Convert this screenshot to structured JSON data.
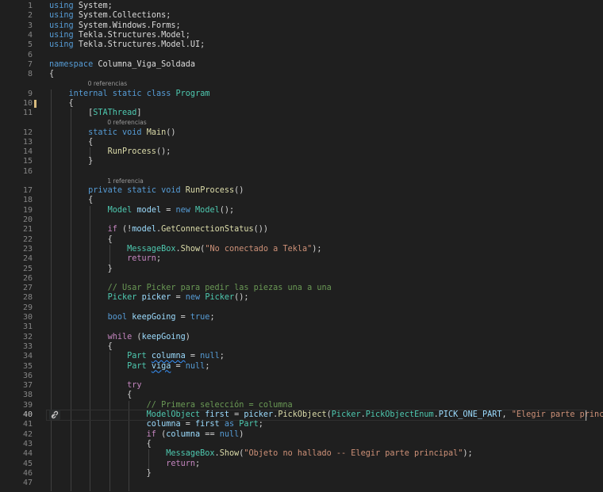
{
  "editor": {
    "active_line": "40",
    "lines": [
      {
        "num": "1",
        "tokens": [
          {
            "t": "using",
            "c": "kw"
          },
          {
            "t": " ",
            "c": "plain"
          },
          {
            "t": "System",
            "c": "ns"
          },
          {
            "t": ";",
            "c": "plain"
          }
        ]
      },
      {
        "num": "2",
        "tokens": [
          {
            "t": "using",
            "c": "kw"
          },
          {
            "t": " ",
            "c": "plain"
          },
          {
            "t": "System.Collections",
            "c": "ns"
          },
          {
            "t": ";",
            "c": "plain"
          }
        ]
      },
      {
        "num": "3",
        "tokens": [
          {
            "t": "using",
            "c": "kw"
          },
          {
            "t": " ",
            "c": "plain"
          },
          {
            "t": "System.Windows.Forms",
            "c": "ns"
          },
          {
            "t": ";",
            "c": "plain"
          }
        ]
      },
      {
        "num": "4",
        "tokens": [
          {
            "t": "using",
            "c": "kw"
          },
          {
            "t": " ",
            "c": "plain"
          },
          {
            "t": "Tekla.Structures.Model",
            "c": "ns"
          },
          {
            "t": ";",
            "c": "plain"
          }
        ]
      },
      {
        "num": "5",
        "tokens": [
          {
            "t": "using",
            "c": "kw"
          },
          {
            "t": " ",
            "c": "plain"
          },
          {
            "t": "Tekla.Structures.Model.UI",
            "c": "ns"
          },
          {
            "t": ";",
            "c": "plain"
          }
        ]
      },
      {
        "num": "6",
        "tokens": []
      },
      {
        "num": "7",
        "tokens": [
          {
            "t": "namespace",
            "c": "kw"
          },
          {
            "t": " ",
            "c": "plain"
          },
          {
            "t": "Columna_Viga_Soldada",
            "c": "ns"
          }
        ]
      },
      {
        "num": "8",
        "tokens": [
          {
            "t": "{",
            "c": "plain"
          }
        ]
      },
      {
        "num": "9",
        "ref": "0 referencias",
        "tokens": [
          {
            "t": "    ",
            "c": "plain"
          },
          {
            "t": "internal",
            "c": "kw"
          },
          {
            "t": " ",
            "c": "plain"
          },
          {
            "t": "static",
            "c": "kw"
          },
          {
            "t": " ",
            "c": "plain"
          },
          {
            "t": "class",
            "c": "kw"
          },
          {
            "t": " ",
            "c": "plain"
          },
          {
            "t": "Program",
            "c": "type"
          }
        ]
      },
      {
        "num": "10",
        "changed": true,
        "tokens": [
          {
            "t": "    {",
            "c": "plain"
          }
        ]
      },
      {
        "num": "11",
        "tokens": [
          {
            "t": "        [",
            "c": "plain"
          },
          {
            "t": "STAThread",
            "c": "attr"
          },
          {
            "t": "]",
            "c": "plain"
          }
        ]
      },
      {
        "num": "12",
        "ref": "0 referencias",
        "tokens": [
          {
            "t": "        ",
            "c": "plain"
          },
          {
            "t": "static",
            "c": "kw"
          },
          {
            "t": " ",
            "c": "plain"
          },
          {
            "t": "void",
            "c": "kw"
          },
          {
            "t": " ",
            "c": "plain"
          },
          {
            "t": "Main",
            "c": "fn"
          },
          {
            "t": "()",
            "c": "plain"
          }
        ]
      },
      {
        "num": "13",
        "tokens": [
          {
            "t": "        {",
            "c": "plain"
          }
        ]
      },
      {
        "num": "14",
        "tokens": [
          {
            "t": "            ",
            "c": "plain"
          },
          {
            "t": "RunProcess",
            "c": "fn"
          },
          {
            "t": "();",
            "c": "plain"
          }
        ]
      },
      {
        "num": "15",
        "tokens": [
          {
            "t": "        }",
            "c": "plain"
          }
        ]
      },
      {
        "num": "16",
        "tokens": []
      },
      {
        "num": "17",
        "ref": "1 referencia",
        "tokens": [
          {
            "t": "        ",
            "c": "plain"
          },
          {
            "t": "private",
            "c": "kw"
          },
          {
            "t": " ",
            "c": "plain"
          },
          {
            "t": "static",
            "c": "kw"
          },
          {
            "t": " ",
            "c": "plain"
          },
          {
            "t": "void",
            "c": "kw"
          },
          {
            "t": " ",
            "c": "plain"
          },
          {
            "t": "RunProcess",
            "c": "fn"
          },
          {
            "t": "()",
            "c": "plain"
          }
        ]
      },
      {
        "num": "18",
        "tokens": [
          {
            "t": "        {",
            "c": "plain"
          }
        ]
      },
      {
        "num": "19",
        "tokens": [
          {
            "t": "            ",
            "c": "plain"
          },
          {
            "t": "Model",
            "c": "type"
          },
          {
            "t": " ",
            "c": "plain"
          },
          {
            "t": "model",
            "c": "var"
          },
          {
            "t": " = ",
            "c": "plain"
          },
          {
            "t": "new",
            "c": "kw"
          },
          {
            "t": " ",
            "c": "plain"
          },
          {
            "t": "Model",
            "c": "type"
          },
          {
            "t": "();",
            "c": "plain"
          }
        ]
      },
      {
        "num": "20",
        "tokens": []
      },
      {
        "num": "21",
        "tokens": [
          {
            "t": "            ",
            "c": "plain"
          },
          {
            "t": "if",
            "c": "ctl"
          },
          {
            "t": " (!",
            "c": "plain"
          },
          {
            "t": "model",
            "c": "var"
          },
          {
            "t": ".",
            "c": "plain"
          },
          {
            "t": "GetConnectionStatus",
            "c": "fn"
          },
          {
            "t": "())",
            "c": "plain"
          }
        ]
      },
      {
        "num": "22",
        "tokens": [
          {
            "t": "            {",
            "c": "plain"
          }
        ]
      },
      {
        "num": "23",
        "tokens": [
          {
            "t": "                ",
            "c": "plain"
          },
          {
            "t": "MessageBox",
            "c": "type"
          },
          {
            "t": ".",
            "c": "plain"
          },
          {
            "t": "Show",
            "c": "fn"
          },
          {
            "t": "(",
            "c": "plain"
          },
          {
            "t": "\"No conectado a Tekla\"",
            "c": "str"
          },
          {
            "t": ");",
            "c": "plain"
          }
        ]
      },
      {
        "num": "24",
        "tokens": [
          {
            "t": "                ",
            "c": "plain"
          },
          {
            "t": "return",
            "c": "ctl"
          },
          {
            "t": ";",
            "c": "plain"
          }
        ]
      },
      {
        "num": "25",
        "tokens": [
          {
            "t": "            }",
            "c": "plain"
          }
        ]
      },
      {
        "num": "26",
        "tokens": []
      },
      {
        "num": "27",
        "tokens": [
          {
            "t": "            ",
            "c": "plain"
          },
          {
            "t": "// Usar Picker para pedir las piezas una a una",
            "c": "cmt"
          }
        ]
      },
      {
        "num": "28",
        "tokens": [
          {
            "t": "            ",
            "c": "plain"
          },
          {
            "t": "Picker",
            "c": "type"
          },
          {
            "t": " ",
            "c": "plain"
          },
          {
            "t": "picker",
            "c": "var"
          },
          {
            "t": " = ",
            "c": "plain"
          },
          {
            "t": "new",
            "c": "kw"
          },
          {
            "t": " ",
            "c": "plain"
          },
          {
            "t": "Picker",
            "c": "type"
          },
          {
            "t": "();",
            "c": "plain"
          }
        ]
      },
      {
        "num": "29",
        "tokens": []
      },
      {
        "num": "30",
        "tokens": [
          {
            "t": "            ",
            "c": "plain"
          },
          {
            "t": "bool",
            "c": "kw"
          },
          {
            "t": " ",
            "c": "plain"
          },
          {
            "t": "keepGoing",
            "c": "var"
          },
          {
            "t": " = ",
            "c": "plain"
          },
          {
            "t": "true",
            "c": "kw"
          },
          {
            "t": ";",
            "c": "plain"
          }
        ]
      },
      {
        "num": "31",
        "tokens": []
      },
      {
        "num": "32",
        "tokens": [
          {
            "t": "            ",
            "c": "plain"
          },
          {
            "t": "while",
            "c": "ctl"
          },
          {
            "t": " (",
            "c": "plain"
          },
          {
            "t": "keepGoing",
            "c": "var"
          },
          {
            "t": ")",
            "c": "plain"
          }
        ]
      },
      {
        "num": "33",
        "tokens": [
          {
            "t": "            {",
            "c": "plain"
          }
        ]
      },
      {
        "num": "34",
        "tokens": [
          {
            "t": "                ",
            "c": "plain"
          },
          {
            "t": "Part",
            "c": "type"
          },
          {
            "t": " ",
            "c": "plain"
          },
          {
            "t": "columna",
            "c": "var",
            "wavy": true
          },
          {
            "t": " = ",
            "c": "plain"
          },
          {
            "t": "null",
            "c": "kw"
          },
          {
            "t": ";",
            "c": "plain"
          }
        ]
      },
      {
        "num": "35",
        "tokens": [
          {
            "t": "                ",
            "c": "plain"
          },
          {
            "t": "Part",
            "c": "type"
          },
          {
            "t": " ",
            "c": "plain"
          },
          {
            "t": "viga",
            "c": "var",
            "wavy": true
          },
          {
            "t": " = ",
            "c": "plain"
          },
          {
            "t": "null",
            "c": "kw"
          },
          {
            "t": ";",
            "c": "plain"
          }
        ]
      },
      {
        "num": "36",
        "tokens": []
      },
      {
        "num": "37",
        "tokens": [
          {
            "t": "                ",
            "c": "plain"
          },
          {
            "t": "try",
            "c": "ctl"
          }
        ]
      },
      {
        "num": "38",
        "tokens": [
          {
            "t": "                {",
            "c": "plain"
          }
        ]
      },
      {
        "num": "39",
        "tokens": [
          {
            "t": "                    ",
            "c": "plain"
          },
          {
            "t": "// Primera selección = columna",
            "c": "cmt"
          }
        ]
      },
      {
        "num": "40",
        "tokens": [
          {
            "t": "                    ",
            "c": "plain"
          },
          {
            "t": "ModelObject",
            "c": "type"
          },
          {
            "t": " ",
            "c": "plain"
          },
          {
            "t": "first",
            "c": "var"
          },
          {
            "t": " = ",
            "c": "plain"
          },
          {
            "t": "picker",
            "c": "var"
          },
          {
            "t": ".",
            "c": "plain"
          },
          {
            "t": "PickObject",
            "c": "fn"
          },
          {
            "t": "(",
            "c": "plain"
          },
          {
            "t": "Picker",
            "c": "type"
          },
          {
            "t": ".",
            "c": "plain"
          },
          {
            "t": "PickObjectEnum",
            "c": "type"
          },
          {
            "t": ".",
            "c": "plain"
          },
          {
            "t": "PICK_ONE_PART",
            "c": "var"
          },
          {
            "t": ", ",
            "c": "plain"
          },
          {
            "t": "\"Elegir parte principal\"",
            "c": "str"
          },
          {
            "t": ");",
            "c": "plain"
          }
        ]
      },
      {
        "num": "41",
        "tokens": [
          {
            "t": "                    ",
            "c": "plain"
          },
          {
            "t": "columna",
            "c": "var"
          },
          {
            "t": " = ",
            "c": "plain"
          },
          {
            "t": "first",
            "c": "var"
          },
          {
            "t": " ",
            "c": "plain"
          },
          {
            "t": "as",
            "c": "kw"
          },
          {
            "t": " ",
            "c": "plain"
          },
          {
            "t": "Part",
            "c": "type"
          },
          {
            "t": ";",
            "c": "plain"
          }
        ]
      },
      {
        "num": "42",
        "tokens": [
          {
            "t": "                    ",
            "c": "plain"
          },
          {
            "t": "if",
            "c": "ctl"
          },
          {
            "t": " (",
            "c": "plain"
          },
          {
            "t": "columna",
            "c": "var"
          },
          {
            "t": " == ",
            "c": "plain"
          },
          {
            "t": "null",
            "c": "kw"
          },
          {
            "t": ")",
            "c": "plain"
          }
        ]
      },
      {
        "num": "43",
        "tokens": [
          {
            "t": "                    {",
            "c": "plain"
          }
        ]
      },
      {
        "num": "44",
        "tokens": [
          {
            "t": "                        ",
            "c": "plain"
          },
          {
            "t": "MessageBox",
            "c": "type"
          },
          {
            "t": ".",
            "c": "plain"
          },
          {
            "t": "Show",
            "c": "fn"
          },
          {
            "t": "(",
            "c": "plain"
          },
          {
            "t": "\"Objeto no hallado -- Elegir parte principal\"",
            "c": "str"
          },
          {
            "t": ");",
            "c": "plain"
          }
        ]
      },
      {
        "num": "45",
        "tokens": [
          {
            "t": "                        ",
            "c": "plain"
          },
          {
            "t": "return",
            "c": "ctl"
          },
          {
            "t": ";",
            "c": "plain"
          }
        ]
      },
      {
        "num": "46",
        "tokens": [
          {
            "t": "                    }",
            "c": "plain"
          }
        ]
      },
      {
        "num": "47",
        "tokens": []
      }
    ]
  }
}
